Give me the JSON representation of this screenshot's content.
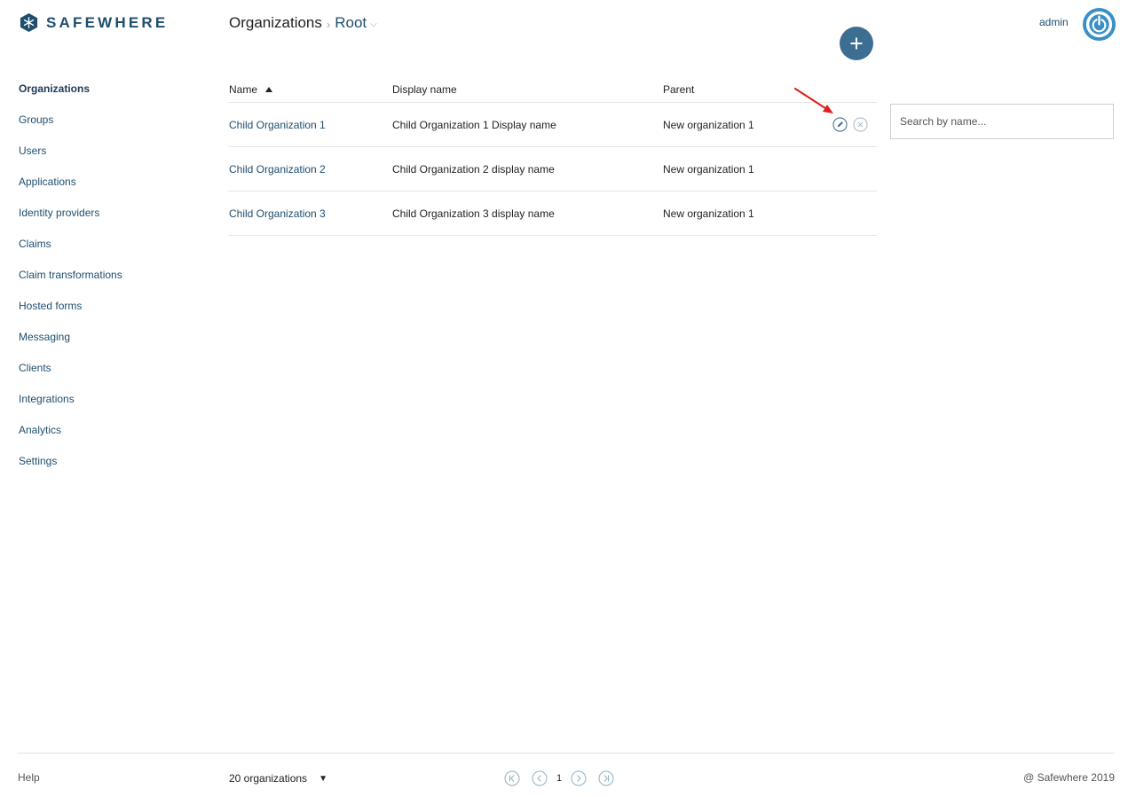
{
  "brand": {
    "name": "SAFEWHERE"
  },
  "breadcrumb": {
    "section": "Organizations",
    "current": "Root"
  },
  "user": {
    "name": "admin"
  },
  "sidebar": {
    "items": [
      {
        "label": "Organizations",
        "active": true
      },
      {
        "label": "Groups"
      },
      {
        "label": "Users"
      },
      {
        "label": "Applications"
      },
      {
        "label": "Identity providers"
      },
      {
        "label": "Claims"
      },
      {
        "label": "Claim transformations"
      },
      {
        "label": "Hosted forms"
      },
      {
        "label": "Messaging"
      },
      {
        "label": "Clients"
      },
      {
        "label": "Integrations"
      },
      {
        "label": "Analytics"
      },
      {
        "label": "Settings"
      }
    ]
  },
  "table": {
    "columns": [
      "Name",
      "Display name",
      "Parent"
    ],
    "sorted_column": "Name",
    "sort_direction": "ascending",
    "rows": [
      {
        "name": "Child Organization 1",
        "display_name": "Child Organization 1 Display name",
        "parent": "New organization 1"
      },
      {
        "name": "Child Organization 2",
        "display_name": "Child Organization 2 display name",
        "parent": "New organization 1"
      },
      {
        "name": "Child Organization 3",
        "display_name": "Child Organization 3 display name",
        "parent": "New organization 1"
      }
    ]
  },
  "search": {
    "placeholder": "Search by name...",
    "value": ""
  },
  "footer": {
    "help": "Help",
    "page_size": "20 organizations",
    "current_page": "1",
    "copyright": "@ Safewhere 2019"
  },
  "icons": {
    "add": "plus-icon",
    "power": "power-icon",
    "edit": "pencil-icon",
    "delete": "close-circle-icon",
    "first": "first-page-icon",
    "prev": "chevron-left-icon",
    "next": "chevron-right-icon",
    "last": "last-page-icon"
  },
  "colors": {
    "brand": "#1f4e6e",
    "accent": "#3c6e92",
    "power": "#3a8fc7",
    "annotation": "#e02020"
  }
}
